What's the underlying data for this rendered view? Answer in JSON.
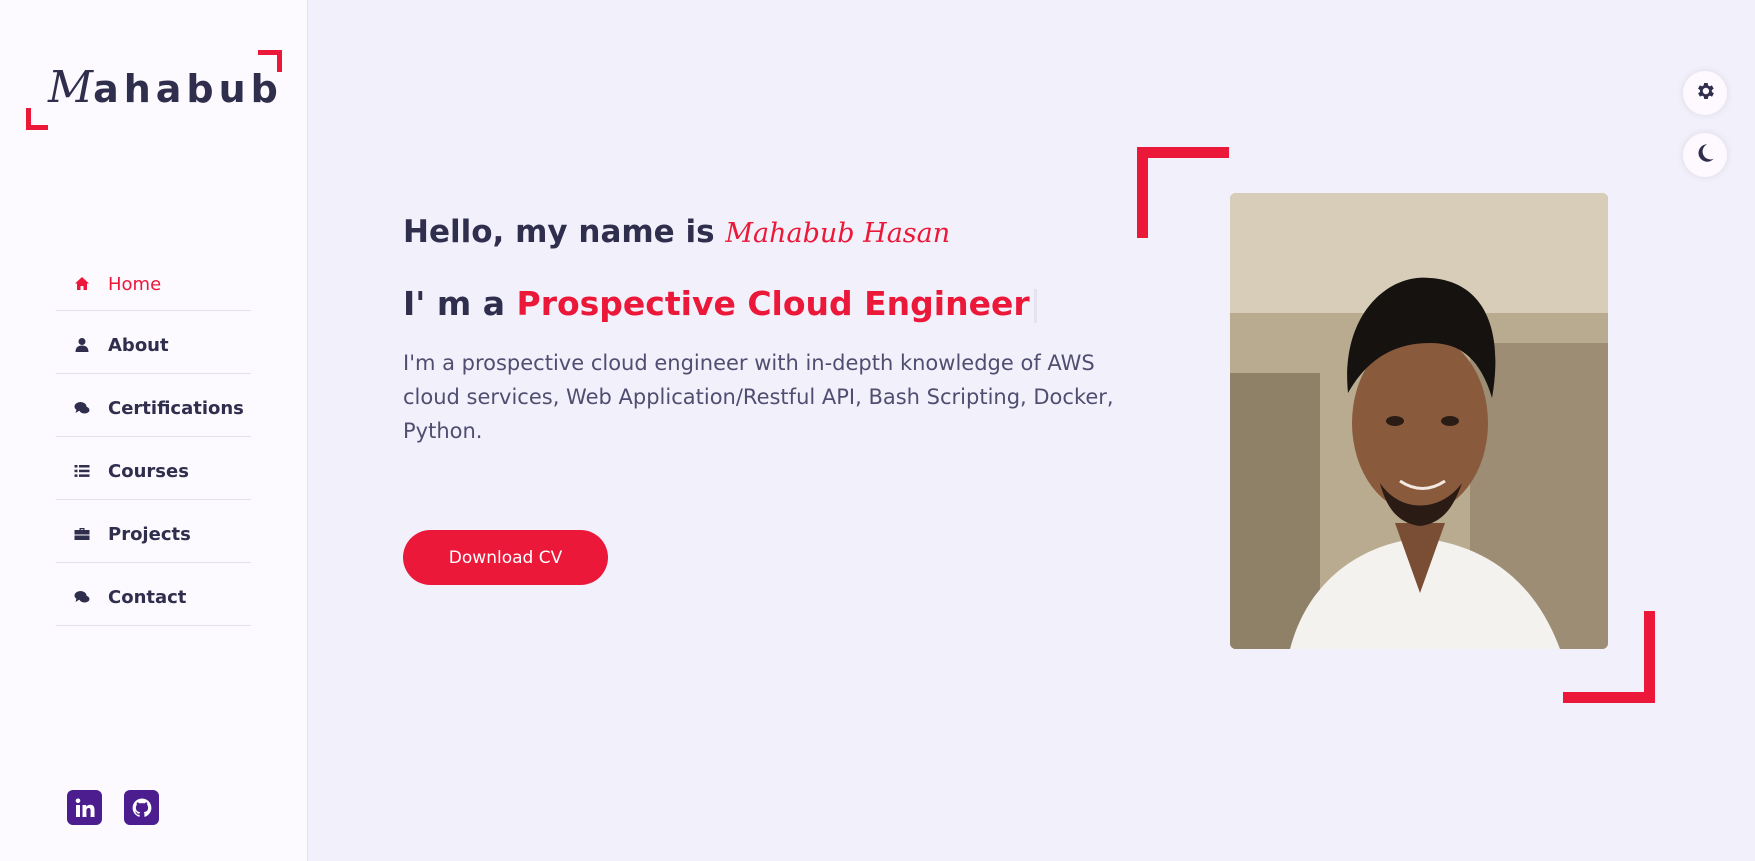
{
  "logo": {
    "initial": "M",
    "rest": "ahabub"
  },
  "nav": {
    "items": [
      {
        "label": "Home",
        "icon": "home-icon",
        "active": true
      },
      {
        "label": "About",
        "icon": "user-icon",
        "active": false
      },
      {
        "label": "Certifications",
        "icon": "comments-icon",
        "active": false
      },
      {
        "label": "Courses",
        "icon": "list-icon",
        "active": false
      },
      {
        "label": "Projects",
        "icon": "briefcase-icon",
        "active": false
      },
      {
        "label": "Contact",
        "icon": "comments-icon",
        "active": false
      }
    ]
  },
  "socials": [
    {
      "name": "linkedin-icon"
    },
    {
      "name": "github-icon"
    }
  ],
  "hero": {
    "greeting": "Hello, my name is ",
    "name": "Mahabub Hasan",
    "role_prefix": "I' m a ",
    "role_title": "Prospective Cloud Engineer",
    "description": "I'm a prospective cloud engineer with in-depth knowledge of AWS cloud services, Web Application/Restful API, Bash Scripting, Docker, Python.",
    "download_label": "Download CV"
  },
  "colors": {
    "accent": "#ec1839",
    "text_dark": "#302e4d",
    "background": "#f2f1fb",
    "sidebar": "#fcf9ff",
    "social": "#4b1d8f"
  },
  "float_buttons": [
    "gear-icon",
    "moon-icon"
  ]
}
